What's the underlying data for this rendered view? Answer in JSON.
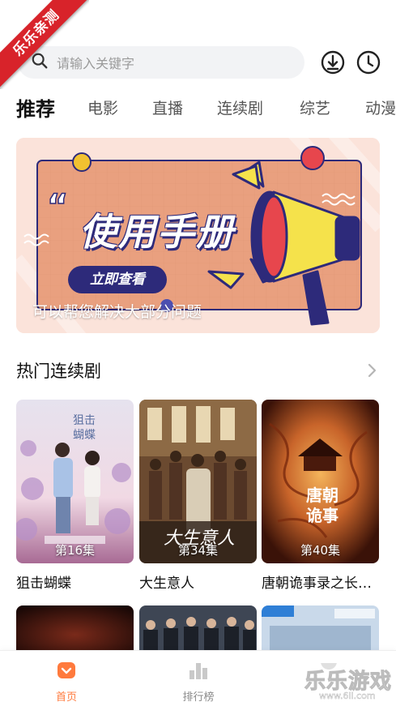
{
  "ribbon": {
    "text": "乐乐亲测"
  },
  "search": {
    "placeholder": "请输入关键字"
  },
  "header_icons": [
    "download-icon",
    "history-icon"
  ],
  "tabs": [
    {
      "label": "推荐",
      "active": true
    },
    {
      "label": "电影"
    },
    {
      "label": "直播"
    },
    {
      "label": "连续剧"
    },
    {
      "label": "综艺"
    },
    {
      "label": "动漫"
    }
  ],
  "banner": {
    "title": "使用手册",
    "button": "立即查看",
    "caption": "可以帮您解决大部分问题"
  },
  "section": {
    "title": "热门连续剧"
  },
  "cards": [
    {
      "title": "狙击蝴蝶",
      "episodes": "第16集"
    },
    {
      "title": "大生意人",
      "episodes": "第34集"
    },
    {
      "title": "唐朝诡事录之长…",
      "episodes": "第40集"
    }
  ],
  "nav": [
    {
      "label": "首页",
      "active": true
    },
    {
      "label": "排行榜"
    }
  ],
  "watermark": {
    "brand": "乐乐游戏",
    "url": "www.6ll.com"
  },
  "colors": {
    "accent": "#ff7a3d",
    "ribbon": "#d8232a",
    "banner_navy": "#2d2a7a"
  }
}
